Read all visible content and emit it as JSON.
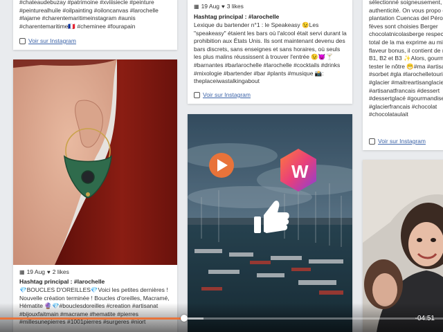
{
  "colors": {
    "accent": "#e8733a",
    "link": "#3b63a8",
    "progress": "#e8733a"
  },
  "left_col": {
    "top_text": "#chateaudebuzay #patrimoine #xviiisiecle #peinture #peinturealhuile #oilpainting #oiloncanvas #larochelle #lajarne #charentemaritimeinstagram #aunis #charentemaritime🇫🇷 #cheminee #fourapain",
    "top_link": "Voir sur Instagram",
    "photo_alt": "earring photo",
    "date": "19 Aug",
    "likes": "2 likes",
    "hashtag": "Hashtag principal : #larochelle",
    "text": "💎BOUCLES D'OREILLES💎Voici les petites dernières ! Nouvelle création terminée ! Boucles d'oreilles, Macramé, Hématite 🔮💎#bouclesdoreilles #creation #artisanat #bijouxfaitmain #macrame #hematite #pierres #millesunepierres #1001pierres #surgeres #niort"
  },
  "mid_col": {
    "date": "19 Aug",
    "likes": "3 likes",
    "hashtag": "Hashtag principal : #larochelle",
    "text": "Lexique du bartender n°1 : le Speakeasy 😉Les \"speakeasy\" étaient les bars où l'alcool était servi durant la prohibition aux États Unis. Ils sont maintenant devenu des bars discrets, sans enseignes et sans horaires, où seuls les plus malins réussissent à trouver l'entrée 😉👿🍸 #barnantes #barlarochelle #larochelle #cocktails #drinks #mixologie #bartender #bar #plants #musique 📸: theplaceiwastalkingabout",
    "link": "Voir sur Instagram",
    "video_label": "harbour video"
  },
  "right_col": {
    "text": "sélectionné soigneusement, authenticité. On vous propo de la plantation Cuencas del Pérou. Les fèves sont choisies Berger chocolatnicolasberge respect le plus total de la ma exprime au mieux les flaveur bonus, il contient de nombre B1, B2 et B3 ✨Alors, gourm Venez tester le nôtre 😁#ma #artisanatlocal #sorbet #gla #larochelletourisme #glacier #maitreartisanglacier #glace #artisanatfrancais #dessert #dessertglacé #gourmandise #glacierfrancais #chocolat #chocolataulait",
    "link": "Voir sur Instagram"
  },
  "player": {
    "time": "-04:51",
    "progress": 0.415,
    "buffered": 0.46
  }
}
